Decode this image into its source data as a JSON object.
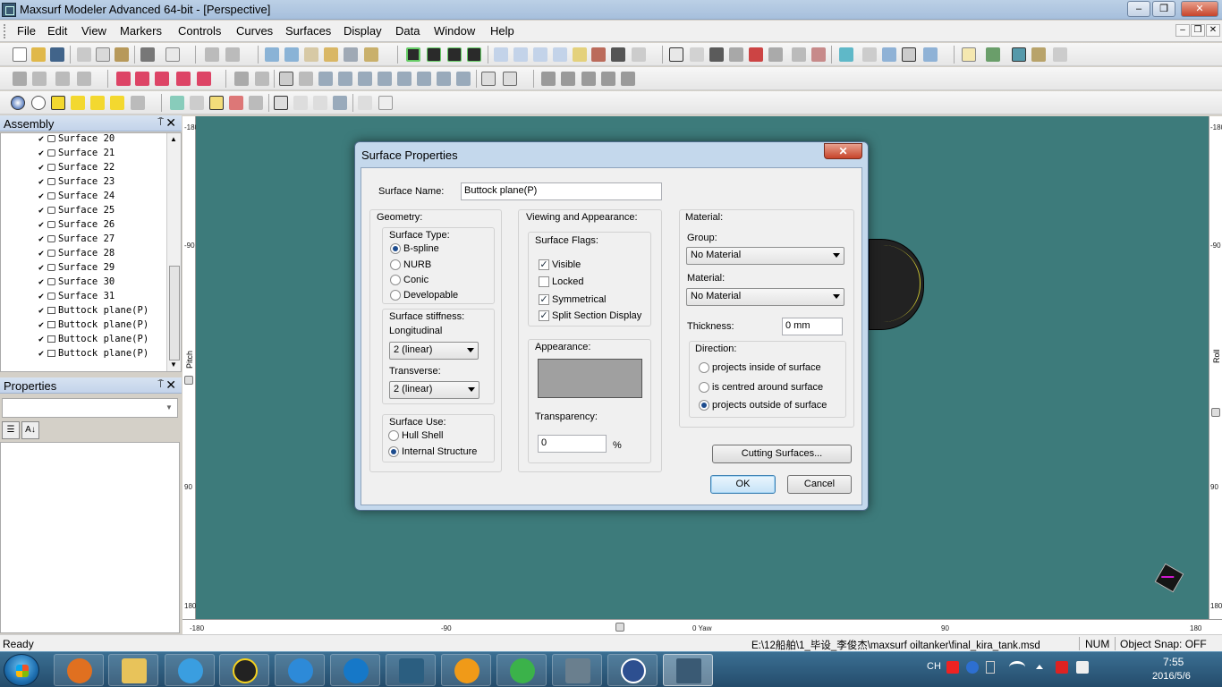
{
  "window": {
    "title": "Maxsurf Modeler Advanced 64-bit - [Perspective]",
    "minimize": "–",
    "restore": "❒",
    "close": "✕"
  },
  "menu": {
    "items": [
      "File",
      "Edit",
      "View",
      "Markers",
      "Controls",
      "Curves",
      "Surfaces",
      "Display",
      "Data",
      "Window",
      "Help"
    ],
    "mdi_minimize": "–",
    "mdi_restore": "❒",
    "mdi_close": "✕"
  },
  "assembly_pane": {
    "title": "Assembly",
    "pin": "⍑",
    "close": "✕",
    "check": "✔",
    "items": [
      "Surface 20",
      "Surface 21",
      "Surface 22",
      "Surface 23",
      "Surface 24",
      "Surface 25",
      "Surface 26",
      "Surface 27",
      "Surface 28",
      "Surface 29",
      "Surface 30",
      "Surface 31",
      "Buttock plane(P)",
      "Buttock plane(P)",
      "Buttock plane(P)",
      "Buttock plane(P)"
    ]
  },
  "properties_pane": {
    "title": "Properties",
    "pin": "⍑",
    "close": "✕",
    "categorized_icon_text": "☰",
    "alpha_icon_text": "A↓"
  },
  "viewport": {
    "left_ruler": [
      "-180",
      "-90",
      "Pitch",
      "90",
      "180"
    ],
    "right_ruler": [
      "-180",
      "-90",
      "Roll",
      "90",
      "180"
    ],
    "bottom_ruler": [
      "-180",
      "-90",
      "0 Yaw",
      "90",
      "180"
    ],
    "background_color": "#3d7b7b"
  },
  "dialog": {
    "title": "Surface Properties",
    "close": "✕",
    "surface_name_label": "Surface Name:",
    "surface_name_value": "Buttock plane(P)",
    "geometry_label": "Geometry:",
    "surface_type_label": "Surface Type:",
    "surface_types": [
      "B-spline",
      "NURB",
      "Conic",
      "Developable"
    ],
    "surface_type_selected": "B-spline",
    "stiffness_label": "Surface stiffness:",
    "longitudinal_label": "Longitudinal",
    "longitudinal_value": "2 (linear)",
    "transverse_label": "Transverse:",
    "transverse_value": "2 (linear)",
    "surface_use_label": "Surface Use:",
    "surface_uses": [
      "Hull Shell",
      "Internal Structure"
    ],
    "surface_use_selected": "Internal Structure",
    "viewing_label": "Viewing and Appearance:",
    "flags_label": "Surface Flags:",
    "flags": [
      {
        "label": "Visible",
        "checked": true
      },
      {
        "label": "Locked",
        "checked": false
      },
      {
        "label": "Symmetrical",
        "checked": true
      },
      {
        "label": "Split Section Display",
        "checked": true
      }
    ],
    "check_mark": "✓",
    "appearance_label": "Appearance:",
    "appearance_color": "#a0a0a0",
    "transparency_label": "Transparency:",
    "transparency_value": "0",
    "percent": "%",
    "material_section_label": "Material:",
    "group_label": "Group:",
    "group_value": "No Material",
    "material_label": "Material:",
    "material_value": "No Material",
    "thickness_label": "Thickness:",
    "thickness_value": "0 mm",
    "direction_label": "Direction:",
    "directions": [
      "projects inside of surface",
      "is centred around surface",
      "projects outside of surface"
    ],
    "direction_selected": "projects outside of surface",
    "cutting_button": "Cutting Surfaces...",
    "ok_button": "OK",
    "cancel_button": "Cancel"
  },
  "statusbar": {
    "status": "Ready",
    "path": "E:\\12船舶\\1_毕设_李俊杰\\maxsurf oiltanker\\final_kira_tank.msd",
    "num": "NUM",
    "snap": "Object Snap: OFF"
  },
  "taskbar": {
    "lang": "CH",
    "time": "7:55",
    "date": "2016/5/6"
  }
}
